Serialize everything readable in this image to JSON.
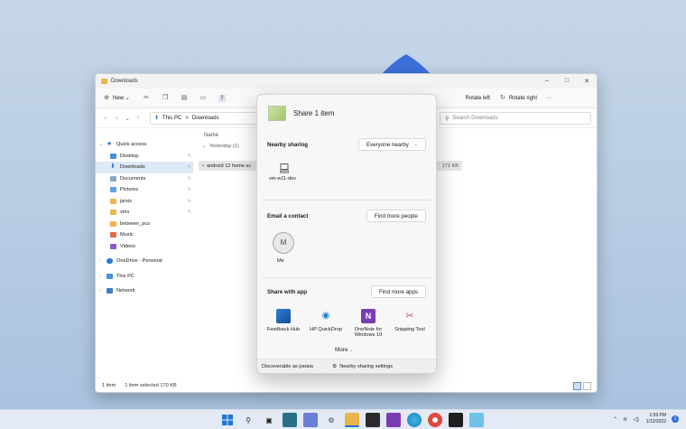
{
  "window": {
    "title": "Downloads"
  },
  "command_bar": {
    "new_label": "New",
    "rotate_left_label": "Rotate left",
    "rotate_right_label": "Rotate right",
    "more_label": "···"
  },
  "address": {
    "segments": [
      "This PC",
      ">",
      "Downloads"
    ],
    "search_placeholder": "Search Downloads"
  },
  "nav": {
    "quick_access": "Quick access",
    "items": [
      "Desktop",
      "Downloads",
      "Documents",
      "Pictures",
      "jarvis",
      "vms",
      "between_pcs",
      "Music",
      "Videos"
    ],
    "onedrive": "OneDrive - Personal",
    "this_pc": "This PC",
    "network": "Network"
  },
  "content": {
    "column_name": "Name",
    "group": "Yesterday (1)",
    "file_name": "android 12 home sc",
    "file_size": "171 KB"
  },
  "status": {
    "count": "1 item",
    "selected": "1 item selected  170 KB"
  },
  "share": {
    "title": "Share 1 item",
    "nearby_title": "Nearby sharing",
    "nearby_option": "Everyone nearby",
    "device_name": "vm-w11-dev",
    "email_title": "Email a contact",
    "find_people": "Find more people",
    "contact_initial": "M",
    "contact_name": "Me",
    "apps_title": "Share with app",
    "find_apps": "Find more apps",
    "apps": [
      "Feedback Hub",
      "HP QuickDrop",
      "OneNote for Windows 10",
      "Snipping Tool"
    ],
    "more": "More",
    "footer_left": "Discoverable as paraia",
    "footer_right": "Nearby sharing settings"
  },
  "taskbar": {
    "time": "1:59 PM",
    "date": "1/12/2022",
    "badge": "1"
  },
  "colors": {
    "accent": "#2b6fd4",
    "selection": "#dfe9f5",
    "folder": "#e8b64a"
  }
}
